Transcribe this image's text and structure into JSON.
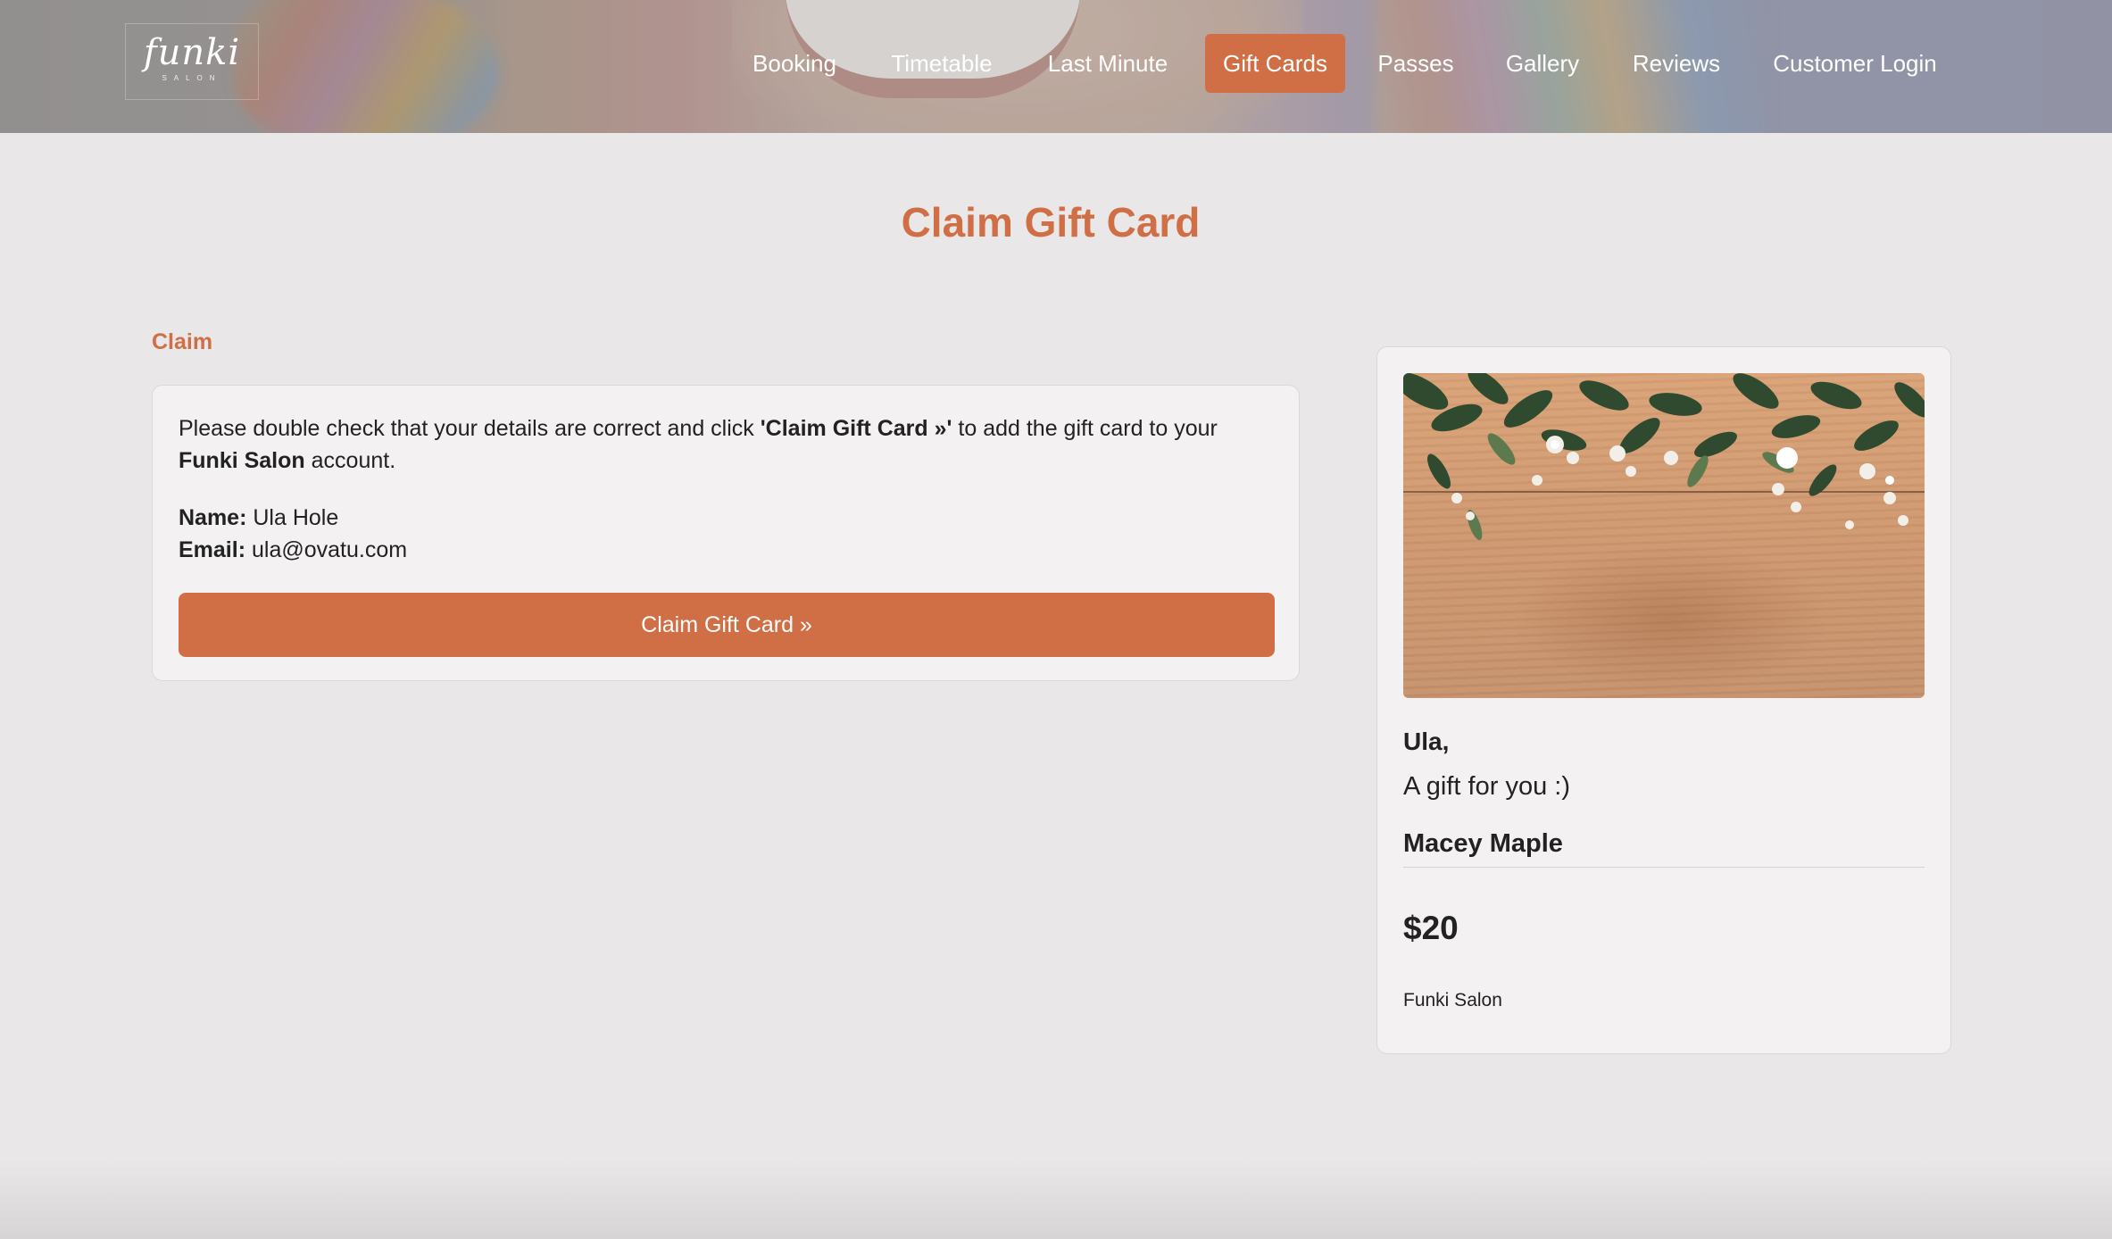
{
  "header": {
    "logo_text": "funki",
    "logo_subtext": "SALON",
    "nav": [
      {
        "label": "Booking",
        "active": false
      },
      {
        "label": "Timetable",
        "active": false
      },
      {
        "label": "Last Minute",
        "active": false
      },
      {
        "label": "Gift Cards",
        "active": true
      },
      {
        "label": "Passes",
        "active": false
      },
      {
        "label": "Gallery",
        "active": false
      },
      {
        "label": "Reviews",
        "active": false
      },
      {
        "label": "Customer Login",
        "active": false
      }
    ]
  },
  "page": {
    "title": "Claim Gift Card",
    "section_label": "Claim"
  },
  "claim": {
    "instruction_part1": "Please double check that your details are correct and click ",
    "instruction_button_ref": "'Claim Gift Card »'",
    "instruction_part2": " to add the gift card to your ",
    "instruction_salon": "Funki Salon",
    "instruction_part3": " account.",
    "name_label": "Name:",
    "name_value": "Ula Hole",
    "email_label": "Email:",
    "email_value": "ula@ovatu.com",
    "button_label": "Claim Gift Card »"
  },
  "gift_card": {
    "image_icon": "flowers-on-wood-image",
    "recipient": "Ula,",
    "message": "A gift for you :)",
    "sender": "Macey Maple",
    "amount": "$20",
    "salon": "Funki Salon"
  },
  "colors": {
    "accent": "#d06f45",
    "background": "#e9e7e8",
    "card": "#f3f1f2"
  }
}
